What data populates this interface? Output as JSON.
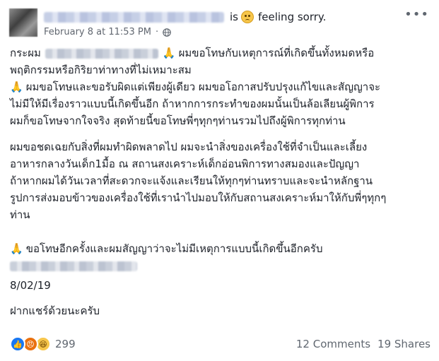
{
  "header": {
    "feeling_verb": "is",
    "feeling_icon": "sad-face-emoji",
    "feeling_text": "feeling sorry.",
    "timestamp": "February 8 at 11:53 PM",
    "separator": "·",
    "privacy_icon": "globe-icon",
    "more_icon": "more-options-icon",
    "more_glyph": "•••"
  },
  "post": {
    "p1_l1_a": "กระผม",
    "p1_l1_b": "ผมขอโทษกับเหตุการณ์ที่เกิดขึ้นทั้งหมดหรือ",
    "p1_l2": "พฤติกรรมหรือกิริยาท่าทางที่ไม่เหมาะสม",
    "p1_l3": "ผมขอโทษและขอรับผิดแต่เพียงผู้เดียว ผมขอโอกาสปรับปรุงแก้ไขและสัญญาจะ",
    "p1_l4": "ไม่มีให้มีเรื่องราวแบบนี้เกิดขึ้นอีก ถ้าหากการกระทำของผมนั้นเป็นล้อเลียนผู้พิการ",
    "p1_l5": "ผมก็ขอโทษจากใจจริง สุดท้ายนี้ขอโทษพี่ๆทุกๆท่านรวมไปถึงผู้พิการทุกท่าน",
    "p2_l1": "ผมขอชดเฉยกับสิ่งที่ผมทำผิดพลาดไป ผมจะนำสิ่งของเครื่องใช้ที่จำเป็นและเลี้ยง",
    "p2_l2": "อาหารกลางวันเด็ก1มื้อ ณ สถานสงเคราะห์เด็กอ่อนพิการทางสมองและปัญญา",
    "p2_l3": "ถ้าหากผมได้วันเวลาที่สะดวกจะแจ้งและเรียนให้ทุกๆท่านทราบและจะนำหลักฐาน",
    "p2_l4": "รูปการส่งมอบข้าวของเครื่องใช้ที่เรานำไปมอบให้กับสถานสงเคราะห์มาให้กับพี่ๆทุกๆ",
    "p2_l5": "ท่าน",
    "p3_l1": "ขอโทษอีกครั้งและผมสัญญาว่าจะไม่มีเหตุการแบบนี้เกิดขึ้นอีกครับ",
    "date": "8/02/19",
    "share_request": "ฝากแชร์ด้วยนะครับ",
    "pray_emoji": "🙏"
  },
  "footer": {
    "reaction_icons": [
      "like-icon",
      "angry-icon",
      "haha-icon"
    ],
    "reaction_count": "299",
    "comments": "12 Comments",
    "shares": "19 Shares"
  }
}
